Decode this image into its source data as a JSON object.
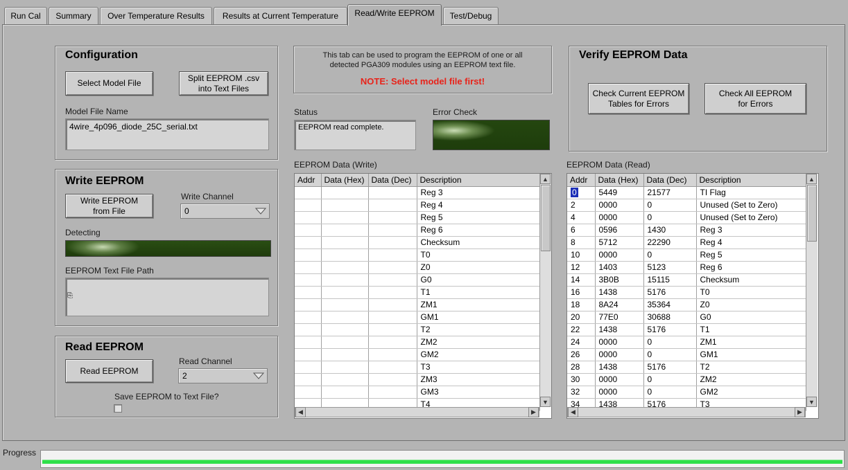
{
  "tabs": [
    {
      "label": "Run Cal"
    },
    {
      "label": "Summary"
    },
    {
      "label": "Over Temperature Results"
    },
    {
      "label": "Results at Current Temperature"
    },
    {
      "label": "Read/Write EEPROM"
    },
    {
      "label": "Test/Debug"
    }
  ],
  "configuration": {
    "title": "Configuration",
    "select_model_label": "Select Model File",
    "split_label": "Split EEPROM .csv\ninto Text Files",
    "model_file_name_label": "Model File Name",
    "model_file_name": "4wire_4p096_diode_25C_serial.txt"
  },
  "info": {
    "text": "This tab can be used to program the EEPROM of one or all\ndetected PGA309 modules using an EEPROM text file.",
    "note": "NOTE: Select model file first!"
  },
  "status": {
    "label": "Status",
    "value": "EEPROM read complete."
  },
  "error_check": {
    "label": "Error Check"
  },
  "verify": {
    "title": "Verify EEPROM Data",
    "check_current_label": "Check Current EEPROM\nTables for Errors",
    "check_all_label": "Check All EEPROM\nfor Errors"
  },
  "write": {
    "title": "Write EEPROM",
    "button_label": "Write EEPROM\nfrom File",
    "channel_label": "Write Channel",
    "channel_value": "0",
    "detecting_label": "Detecting",
    "path_label": "EEPROM Text File Path",
    "path_value": ""
  },
  "read": {
    "title": "Read EEPROM",
    "button_label": "Read EEPROM",
    "channel_label": "Read Channel",
    "channel_value": "2",
    "save_label": "Save EEPROM to Text File?"
  },
  "write_table": {
    "label": "EEPROM Data (Write)",
    "columns": [
      "Addr",
      "Data (Hex)",
      "Data (Dec)",
      "Description"
    ],
    "rows": [
      [
        "",
        "",
        "",
        "Reg 3"
      ],
      [
        "",
        "",
        "",
        "Reg 4"
      ],
      [
        "",
        "",
        "",
        "Reg 5"
      ],
      [
        "",
        "",
        "",
        "Reg 6"
      ],
      [
        "",
        "",
        "",
        "Checksum"
      ],
      [
        "",
        "",
        "",
        "T0"
      ],
      [
        "",
        "",
        "",
        "Z0"
      ],
      [
        "",
        "",
        "",
        "G0"
      ],
      [
        "",
        "",
        "",
        "T1"
      ],
      [
        "",
        "",
        "",
        "ZM1"
      ],
      [
        "",
        "",
        "",
        "GM1"
      ],
      [
        "",
        "",
        "",
        "T2"
      ],
      [
        "",
        "",
        "",
        "ZM2"
      ],
      [
        "",
        "",
        "",
        "GM2"
      ],
      [
        "",
        "",
        "",
        "T3"
      ],
      [
        "",
        "",
        "",
        "ZM3"
      ],
      [
        "",
        "",
        "",
        "GM3"
      ],
      [
        "",
        "",
        "",
        "T4"
      ]
    ]
  },
  "read_table": {
    "label": "EEPROM Data (Read)",
    "columns": [
      "Addr",
      "Data (Hex)",
      "Data (Dec)",
      "Description"
    ],
    "rows": [
      [
        "0",
        "5449",
        "21577",
        "TI Flag"
      ],
      [
        "2",
        "0000",
        "0",
        "Unused (Set to Zero)"
      ],
      [
        "4",
        "0000",
        "0",
        "Unused (Set to Zero)"
      ],
      [
        "6",
        "0596",
        "1430",
        "Reg 3"
      ],
      [
        "8",
        "5712",
        "22290",
        "Reg 4"
      ],
      [
        "10",
        "0000",
        "0",
        "Reg 5"
      ],
      [
        "12",
        "1403",
        "5123",
        "Reg 6"
      ],
      [
        "14",
        "3B0B",
        "15115",
        "Checksum"
      ],
      [
        "16",
        "1438",
        "5176",
        "T0"
      ],
      [
        "18",
        "8A24",
        "35364",
        "Z0"
      ],
      [
        "20",
        "77E0",
        "30688",
        "G0"
      ],
      [
        "22",
        "1438",
        "5176",
        "T1"
      ],
      [
        "24",
        "0000",
        "0",
        "ZM1"
      ],
      [
        "26",
        "0000",
        "0",
        "GM1"
      ],
      [
        "28",
        "1438",
        "5176",
        "T2"
      ],
      [
        "30",
        "0000",
        "0",
        "ZM2"
      ],
      [
        "32",
        "0000",
        "0",
        "GM2"
      ],
      [
        "34",
        "1438",
        "5176",
        "T3"
      ]
    ]
  },
  "progress": {
    "label": "Progress",
    "value": 1.0
  },
  "colors": {
    "note_red": "#e8231a",
    "led_green": "#24460f",
    "progress_green": "#2ee04a",
    "selection_blue": "#1c2fb7"
  }
}
